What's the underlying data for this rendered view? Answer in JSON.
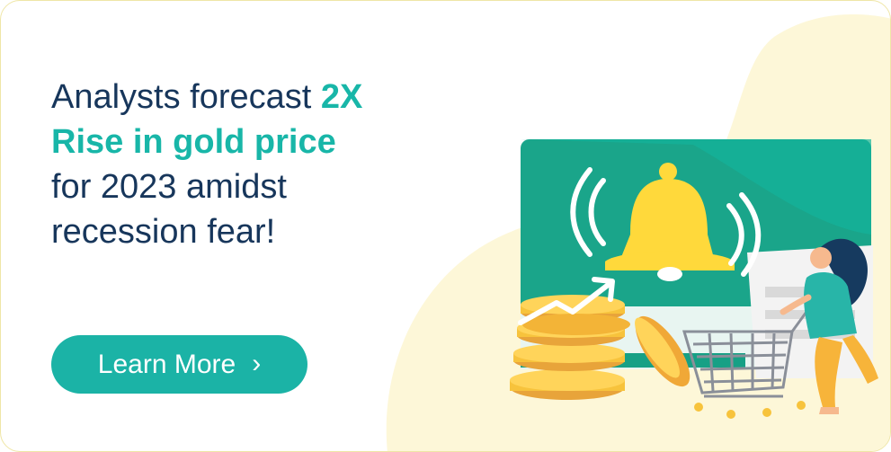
{
  "headline": {
    "line1_text": "Analysts forecast ",
    "line1_accent": "2X",
    "line2": "Rise in gold price",
    "line3": "for 2023 amidst",
    "line4": "recession fear!"
  },
  "cta": {
    "label": "Learn More",
    "icon": "chevron-right-icon",
    "glyph": "›"
  },
  "colors": {
    "teal": "#1bb3a6",
    "navy": "#17365b",
    "cream": "#fdf7d8",
    "gold": "#f7c33c",
    "bell": "#ffd93b"
  }
}
